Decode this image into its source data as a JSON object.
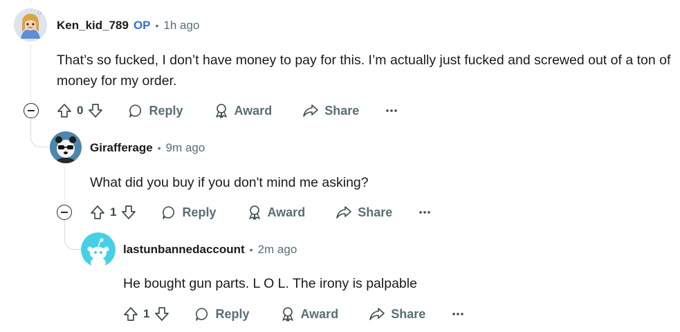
{
  "comments": [
    {
      "author": "Ken_kid_789",
      "op_badge": "OP",
      "time": "1h ago",
      "text": "That’s so fucked, I don’t have money to pay for this. I’m actually just fucked and screwed out of a ton of money for my order.",
      "score": "0",
      "reply_label": "Reply",
      "award_label": "Award",
      "share_label": "Share"
    },
    {
      "author": "Girafferage",
      "time": "9m ago",
      "text": "What did you buy if you don't mind me asking?",
      "score": "1",
      "reply_label": "Reply",
      "award_label": "Award",
      "share_label": "Share"
    },
    {
      "author": "lastunbannedaccount",
      "time": "2m ago",
      "text": "He bought gun parts. L O L. The irony is palpable",
      "score": "1",
      "reply_label": "Reply",
      "award_label": "Award",
      "share_label": "Share"
    }
  ],
  "separator": "•",
  "colors": {
    "op_badge": "#2f6fdc",
    "meta": "#576f76",
    "avatar_teal": "#45d0e6"
  }
}
